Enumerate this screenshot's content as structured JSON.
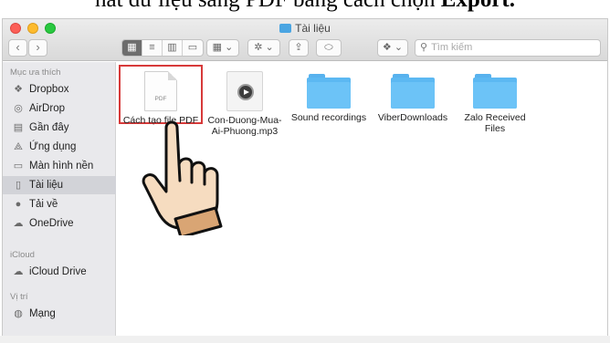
{
  "caption": {
    "prefix": "hat dữ liệu sang PDF bằng cách chọn ",
    "bold": "Export."
  },
  "window": {
    "title": "Tài liệu"
  },
  "toolbar": {
    "back": "‹",
    "forward": "›",
    "view_icons": [
      "grid-view-icon",
      "list-view-icon",
      "column-view-icon",
      "gallery-view-icon"
    ],
    "search_placeholder": "Tìm kiếm"
  },
  "sidebar": {
    "sections": [
      {
        "heading": "Mục ưa thích",
        "items": [
          {
            "label": "Dropbox",
            "icon": "dropbox-icon",
            "glyph": "❖"
          },
          {
            "label": "AirDrop",
            "icon": "airdrop-icon",
            "glyph": "◎"
          },
          {
            "label": "Gần đây",
            "icon": "recent-icon",
            "glyph": "▤"
          },
          {
            "label": "Ứng dụng",
            "icon": "applications-icon",
            "glyph": "⟁"
          },
          {
            "label": "Màn hình nền",
            "icon": "desktop-icon",
            "glyph": "▭"
          },
          {
            "label": "Tài liệu",
            "icon": "documents-icon",
            "glyph": "▯",
            "selected": true
          },
          {
            "label": "Tải về",
            "icon": "downloads-icon",
            "glyph": "●"
          },
          {
            "label": "OneDrive",
            "icon": "onedrive-icon",
            "glyph": "☁"
          }
        ]
      },
      {
        "heading": "iCloud",
        "items": [
          {
            "label": "iCloud Drive",
            "icon": "icloud-icon",
            "glyph": "☁"
          }
        ]
      },
      {
        "heading": "Vị trí",
        "items": [
          {
            "label": "Mạng",
            "icon": "network-icon",
            "glyph": "◍"
          }
        ]
      }
    ]
  },
  "files": [
    {
      "name": "Cách tạo file PDF",
      "type": "pdf",
      "badge": "PDF",
      "selected": true
    },
    {
      "name": "Con-Duong-Mua-Ai-Phuong.mp3",
      "line1": "Con-Duong-Mua-",
      "line2": "Ai-Phuong.mp3",
      "type": "audio"
    },
    {
      "name": "Sound recordings",
      "type": "folder"
    },
    {
      "name": "ViberDownloads",
      "type": "folder"
    },
    {
      "name": "Zalo Received Files",
      "line1": "Zalo Received",
      "line2": "Files",
      "type": "folder"
    }
  ],
  "colors": {
    "selection_border": "#d73a3a",
    "folder": "#5cb8f2",
    "sidebar_bg": "#e9e9ec"
  }
}
